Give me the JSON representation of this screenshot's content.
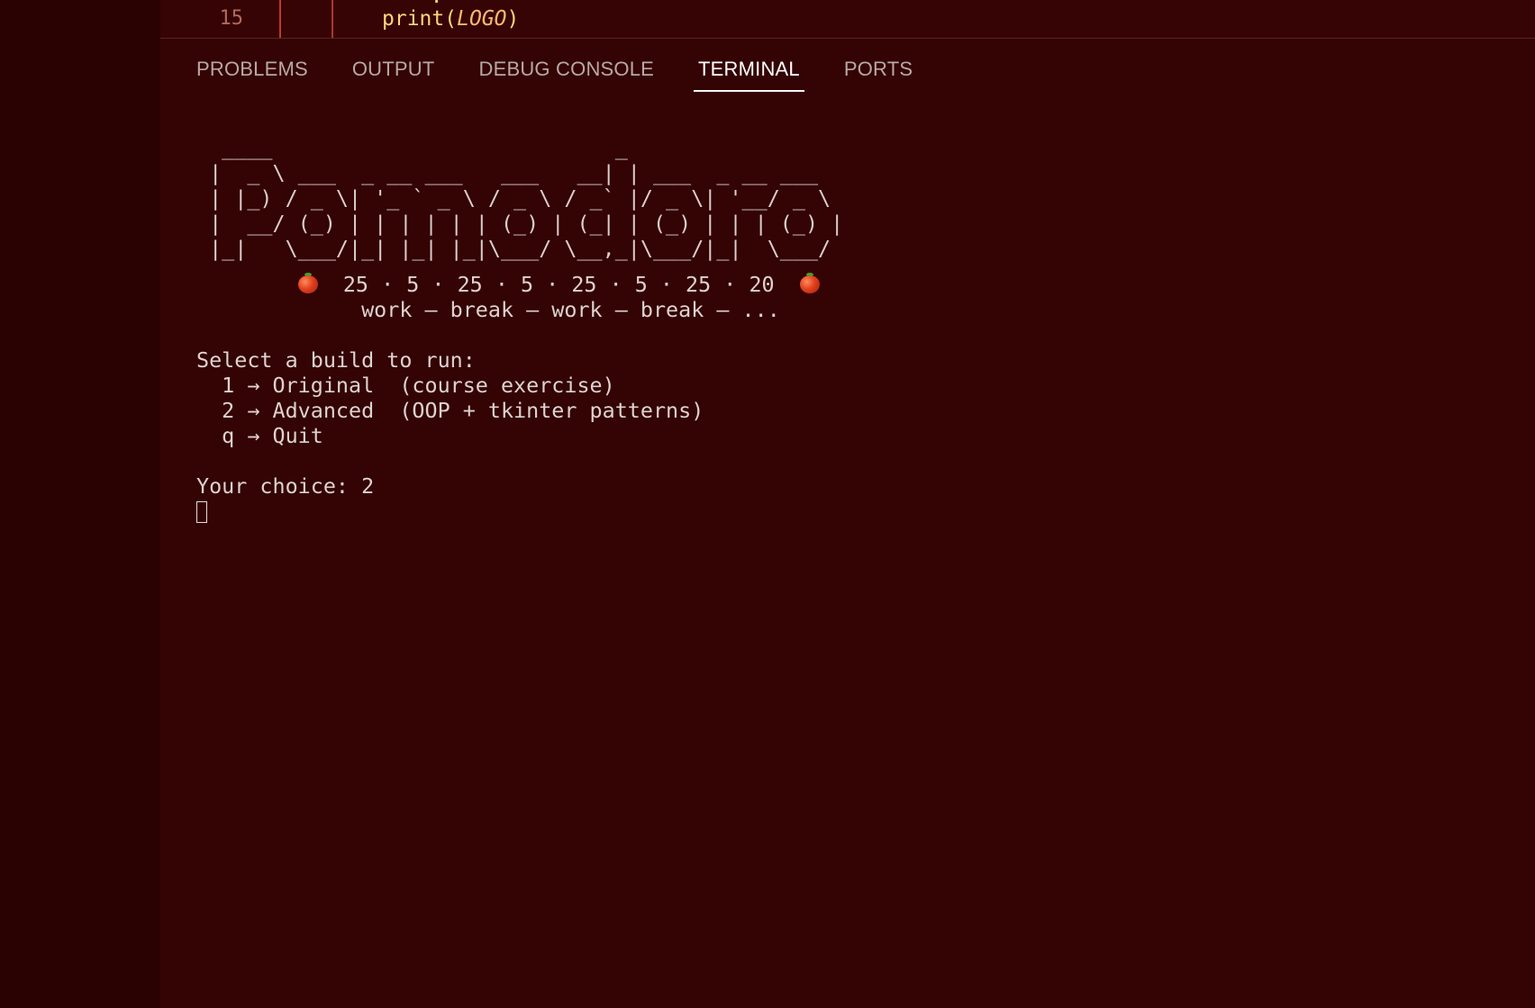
{
  "editor": {
    "line_number": "15",
    "code_func": "print(",
    "code_arg": "LOGO",
    "code_close": ")",
    "code_fragment_above": "."
  },
  "panel": {
    "tabs": [
      {
        "label": "PROBLEMS",
        "active": false
      },
      {
        "label": "OUTPUT",
        "active": false
      },
      {
        "label": "DEBUG CONSOLE",
        "active": false
      },
      {
        "label": "TERMINAL",
        "active": true
      },
      {
        "label": "PORTS",
        "active": false
      }
    ]
  },
  "terminal": {
    "logo_lines": [
      "  ____                           _",
      " |  _ \\ ___  _ __ ___   ___   __| | ___  _ __ ___",
      " | |_) / _ \\| '_ ` _ \\ / _ \\ / _` |/ _ \\| '__/ _ \\",
      " |  __/ (_) | | | | | | (_) | (_| | (_) | | | (_) |",
      " |_|   \\___/|_| |_| |_|\\___/ \\__,_|\\___/|_|  \\___/"
    ],
    "cycle_prefix": "        ",
    "cycle_text": "  25 · 5 · 25 · 5 · 25 · 5 · 25 · 20  ",
    "tagline": "             work — break — work — break — ...",
    "prompt_header": "Select a build to run:",
    "options": [
      "  1 → Original  (course exercise)",
      "  2 → Advanced  (OOP + tkinter patterns)",
      "  q → Quit"
    ],
    "choice_line": "Your choice: 2",
    "icons": {
      "tomato": "tomato-icon",
      "cursor": "block-cursor"
    }
  }
}
